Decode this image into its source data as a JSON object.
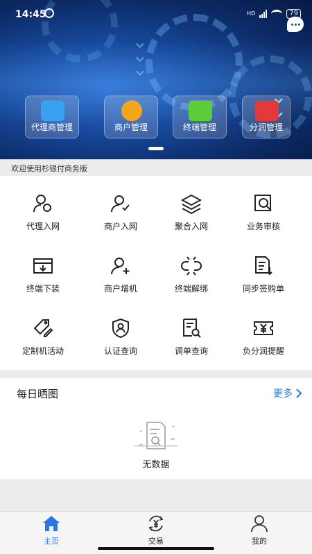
{
  "status_bar": {
    "time": "14:45",
    "battery": "79",
    "network": "HD"
  },
  "banner": {
    "tiles": [
      {
        "label": "代理商管理",
        "icon": "agents-icon"
      },
      {
        "label": "商户管理",
        "icon": "merchant-icon"
      },
      {
        "label": "终端管理",
        "icon": "terminal-icon"
      },
      {
        "label": "分润管理",
        "icon": "profit-icon"
      }
    ]
  },
  "welcome": "欢迎使用杉银付商务版",
  "grid": [
    {
      "label": "代理入网",
      "icon": "agent-onboard-icon"
    },
    {
      "label": "商户入网",
      "icon": "merchant-onboard-icon"
    },
    {
      "label": "聚合入网",
      "icon": "layers-icon"
    },
    {
      "label": "业务审核",
      "icon": "review-search-icon"
    },
    {
      "label": "终端下装",
      "icon": "download-box-icon"
    },
    {
      "label": "商户增机",
      "icon": "user-add-icon"
    },
    {
      "label": "终端解绑",
      "icon": "unlink-icon"
    },
    {
      "label": "同步签购单",
      "icon": "sync-document-icon"
    },
    {
      "label": "定制机活动",
      "icon": "tag-edit-icon"
    },
    {
      "label": "认证查询",
      "icon": "shield-user-icon"
    },
    {
      "label": "调单查询",
      "icon": "document-search-icon"
    },
    {
      "label": "负分润提醒",
      "icon": "yen-ticket-icon"
    }
  ],
  "daily": {
    "title": "每日晒图",
    "more": "更多",
    "empty": "无数据"
  },
  "tabs": [
    {
      "label": "主页",
      "icon": "home-icon",
      "active": true
    },
    {
      "label": "交易",
      "icon": "yen-exchange-icon",
      "active": false
    },
    {
      "label": "我的",
      "icon": "profile-icon",
      "active": false
    }
  ],
  "colors": {
    "accent": "#2b78e4",
    "banner_dark": "#0c2a66"
  }
}
